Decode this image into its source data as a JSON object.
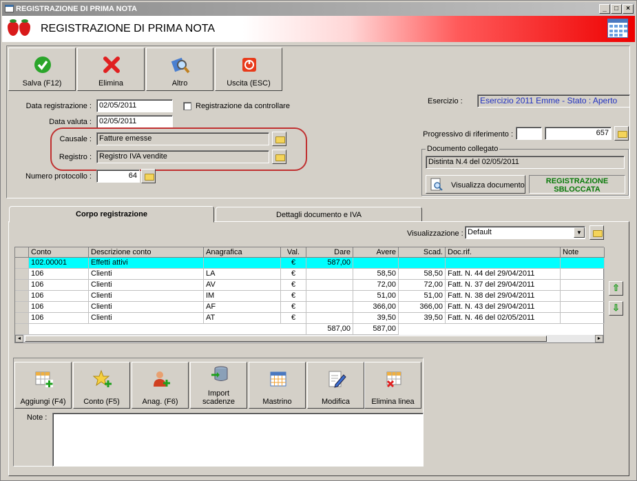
{
  "window": {
    "title": "REGISTRAZIONE DI PRIMA NOTA",
    "min": "_",
    "max": "□",
    "close": "×"
  },
  "banner": {
    "title": "REGISTRAZIONE DI PRIMA NOTA"
  },
  "toolbar": {
    "save": "Salva (F12)",
    "delete": "Elimina",
    "other": "Altro",
    "exit": "Uscita (ESC)"
  },
  "form": {
    "data_registrazione_label": "Data registrazione :",
    "data_registrazione": "02/05/2011",
    "data_valuta_label": "Data valuta :",
    "data_valuta": "02/05/2011",
    "da_controllare_label": "Registrazione da controllare",
    "causale_label": "Causale :",
    "causale": "Fatture emesse",
    "registro_label": "Registro :",
    "registro": "Registro IVA vendite",
    "protocollo_label": "Numero protocollo :",
    "protocollo": "64",
    "esercizio_label": "Esercizio :",
    "esercizio": "Esercizio 2011 Emme - Stato : Aperto",
    "progressivo_label": "Progressivo di riferimento :",
    "progressivo_a": "",
    "progressivo_b": "657",
    "documento_collegato_label": "Documento collegato",
    "documento_collegato": "Distinta N.4 del 02/05/2011",
    "visualizza_documento": "Visualizza documento",
    "stato_registrazione": "REGISTRAZIONE SBLOCCATA"
  },
  "tabs": [
    {
      "label": "Corpo registrazione"
    },
    {
      "label": "Dettagli documento e IVA"
    }
  ],
  "visualizzazione": {
    "label": "Visualizzazione :",
    "value": "Default"
  },
  "grid": {
    "columns": [
      "Conto",
      "Descrizione conto",
      "Anagrafica",
      "Val.",
      "Dare",
      "Avere",
      "Scad.",
      "Doc.rif.",
      "Note"
    ],
    "rows": [
      {
        "conto": "102.00001",
        "descr": "Effetti attivi",
        "anag": "",
        "val": "€",
        "dare": "587,00",
        "avere": "",
        "scad": "",
        "doc": "",
        "note": ""
      },
      {
        "conto": "106",
        "descr": "Clienti",
        "anag": "LA",
        "val": "€",
        "dare": "",
        "avere": "58,50",
        "scad": "58,50",
        "doc": "Fatt. N. 44 del 29/04/2011",
        "note": ""
      },
      {
        "conto": "106",
        "descr": "Clienti",
        "anag": "AV",
        "val": "€",
        "dare": "",
        "avere": "72,00",
        "scad": "72,00",
        "doc": "Fatt. N. 37 del 29/04/2011",
        "note": ""
      },
      {
        "conto": "106",
        "descr": "Clienti",
        "anag": "IM",
        "val": "€",
        "dare": "",
        "avere": "51,00",
        "scad": "51,00",
        "doc": "Fatt. N. 38 del 29/04/2011",
        "note": ""
      },
      {
        "conto": "106",
        "descr": "Clienti",
        "anag": "AF",
        "val": "€",
        "dare": "",
        "avere": "366,00",
        "scad": "366,00",
        "doc": "Fatt. N. 43 del 29/04/2011",
        "note": ""
      },
      {
        "conto": "106",
        "descr": "Clienti",
        "anag": "AT",
        "val": "€",
        "dare": "",
        "avere": "39,50",
        "scad": "39,50",
        "doc": "Fatt. N. 46 del 02/05/2011",
        "note": ""
      }
    ],
    "totals": {
      "dare": "587,00",
      "avere": "587,00"
    }
  },
  "bottom_buttons": {
    "aggiungi": "Aggiungi (F4)",
    "conto": "Conto (F5)",
    "anag": "Anag. (F6)",
    "import": "Import scadenze",
    "mastrino": "Mastrino",
    "modifica": "Modifica",
    "elimina_linea": "Elimina linea"
  },
  "note": {
    "label": "Note :",
    "value": ""
  },
  "colors": {
    "accent_red": "#ee0000",
    "selected_row": "#00ffff",
    "highlight_outline": "#c03030",
    "esercizio_text": "#2030c0"
  }
}
